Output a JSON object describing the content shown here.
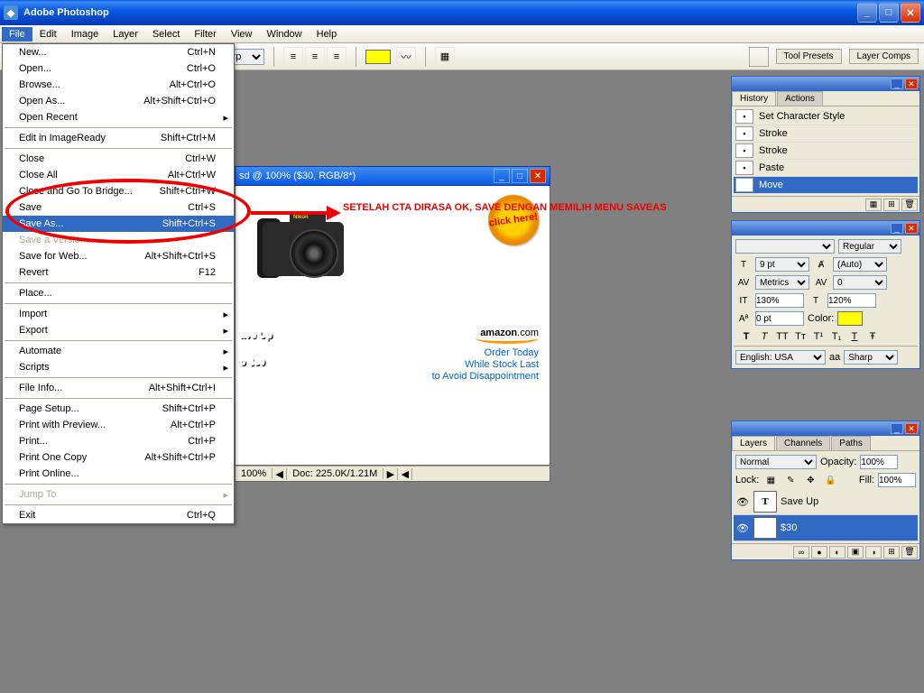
{
  "app_title": "Adobe Photoshop",
  "menubar": [
    "File",
    "Edit",
    "Image",
    "Layer",
    "Select",
    "Filter",
    "View",
    "Window",
    "Help"
  ],
  "optbar": {
    "font_size": "9 pt",
    "aa_label": "aa",
    "aa_mode": "Sharp",
    "tool_presets_tab": "Tool Presets",
    "layer_comps_tab": "Layer Comps"
  },
  "file_menu": [
    {
      "l": "New...",
      "s": "Ctrl+N"
    },
    {
      "l": "Open...",
      "s": "Ctrl+O"
    },
    {
      "l": "Browse...",
      "s": "Alt+Ctrl+O"
    },
    {
      "l": "Open As...",
      "s": "Alt+Shift+Ctrl+O"
    },
    {
      "l": "Open Recent",
      "sub": true
    },
    {
      "hr": true
    },
    {
      "l": "Edit in ImageReady",
      "s": "Shift+Ctrl+M"
    },
    {
      "hr": true
    },
    {
      "l": "Close",
      "s": "Ctrl+W"
    },
    {
      "l": "Close All",
      "s": "Alt+Ctrl+W"
    },
    {
      "l": "Close and Go To Bridge...",
      "s": "Shift+Ctrl+W"
    },
    {
      "l": "Save",
      "s": "Ctrl+S"
    },
    {
      "l": "Save As...",
      "s": "Shift+Ctrl+S",
      "sel": true
    },
    {
      "l": "Save a Version...",
      "dis": true
    },
    {
      "l": "Save for Web...",
      "s": "Alt+Shift+Ctrl+S"
    },
    {
      "l": "Revert",
      "s": "F12"
    },
    {
      "hr": true
    },
    {
      "l": "Place..."
    },
    {
      "hr": true
    },
    {
      "l": "Import",
      "sub": true
    },
    {
      "l": "Export",
      "sub": true
    },
    {
      "hr": true
    },
    {
      "l": "Automate",
      "sub": true
    },
    {
      "l": "Scripts",
      "sub": true
    },
    {
      "hr": true
    },
    {
      "l": "File Info...",
      "s": "Alt+Shift+Ctrl+I"
    },
    {
      "hr": true
    },
    {
      "l": "Page Setup...",
      "s": "Shift+Ctrl+P"
    },
    {
      "l": "Print with Preview...",
      "s": "Alt+Ctrl+P"
    },
    {
      "l": "Print...",
      "s": "Ctrl+P"
    },
    {
      "l": "Print One Copy",
      "s": "Alt+Shift+Ctrl+P"
    },
    {
      "l": "Print Online..."
    },
    {
      "hr": true
    },
    {
      "l": "Jump To",
      "sub": true,
      "dis": true
    },
    {
      "hr": true
    },
    {
      "l": "Exit",
      "s": "Ctrl+Q"
    }
  ],
  "doc": {
    "title": "sd @ 100% ($30, RGB/8*)",
    "zoom": "100%",
    "status": "Doc: 225.0K/1.21M"
  },
  "ad": {
    "starburst": "click here!",
    "camera_brand": "Nikon",
    "headline_line1": "ave Up",
    "headline_line2": "o $30",
    "amazon": "amazon",
    "dotcom": ".com",
    "copy": "Order Today\nWhile Stock Last\nto Avoid Disappointment"
  },
  "annotation": "SETELAH CTA DIRASA OK, SAVE DENGAN MEMILIH MENU SAVEAS",
  "history": {
    "tab1": "History",
    "tab2": "Actions",
    "items": [
      "Set Character Style",
      "Stroke",
      "Stroke",
      "Paste",
      "Move"
    ]
  },
  "character": {
    "tab_hidden": "",
    "style": "Regular",
    "size": "9 pt",
    "leading_label": "(Auto)",
    "metrics": "Metrics",
    "av": "0",
    "hscale": "130%",
    "vscale": "120%",
    "baseline": "0 pt",
    "color_label": "Color:",
    "lang": "English: USA",
    "aa": "aa",
    "aa_mode": "Sharp"
  },
  "layers": {
    "tab1": "Layers",
    "tab2": "Channels",
    "tab3": "Paths",
    "blend": "Normal",
    "opacity_label": "Opacity:",
    "opacity": "100%",
    "lock_label": "Lock:",
    "fill_label": "Fill:",
    "fill": "100%",
    "items": [
      {
        "name": "Save Up"
      },
      {
        "name": "$30",
        "sel": true
      }
    ]
  }
}
